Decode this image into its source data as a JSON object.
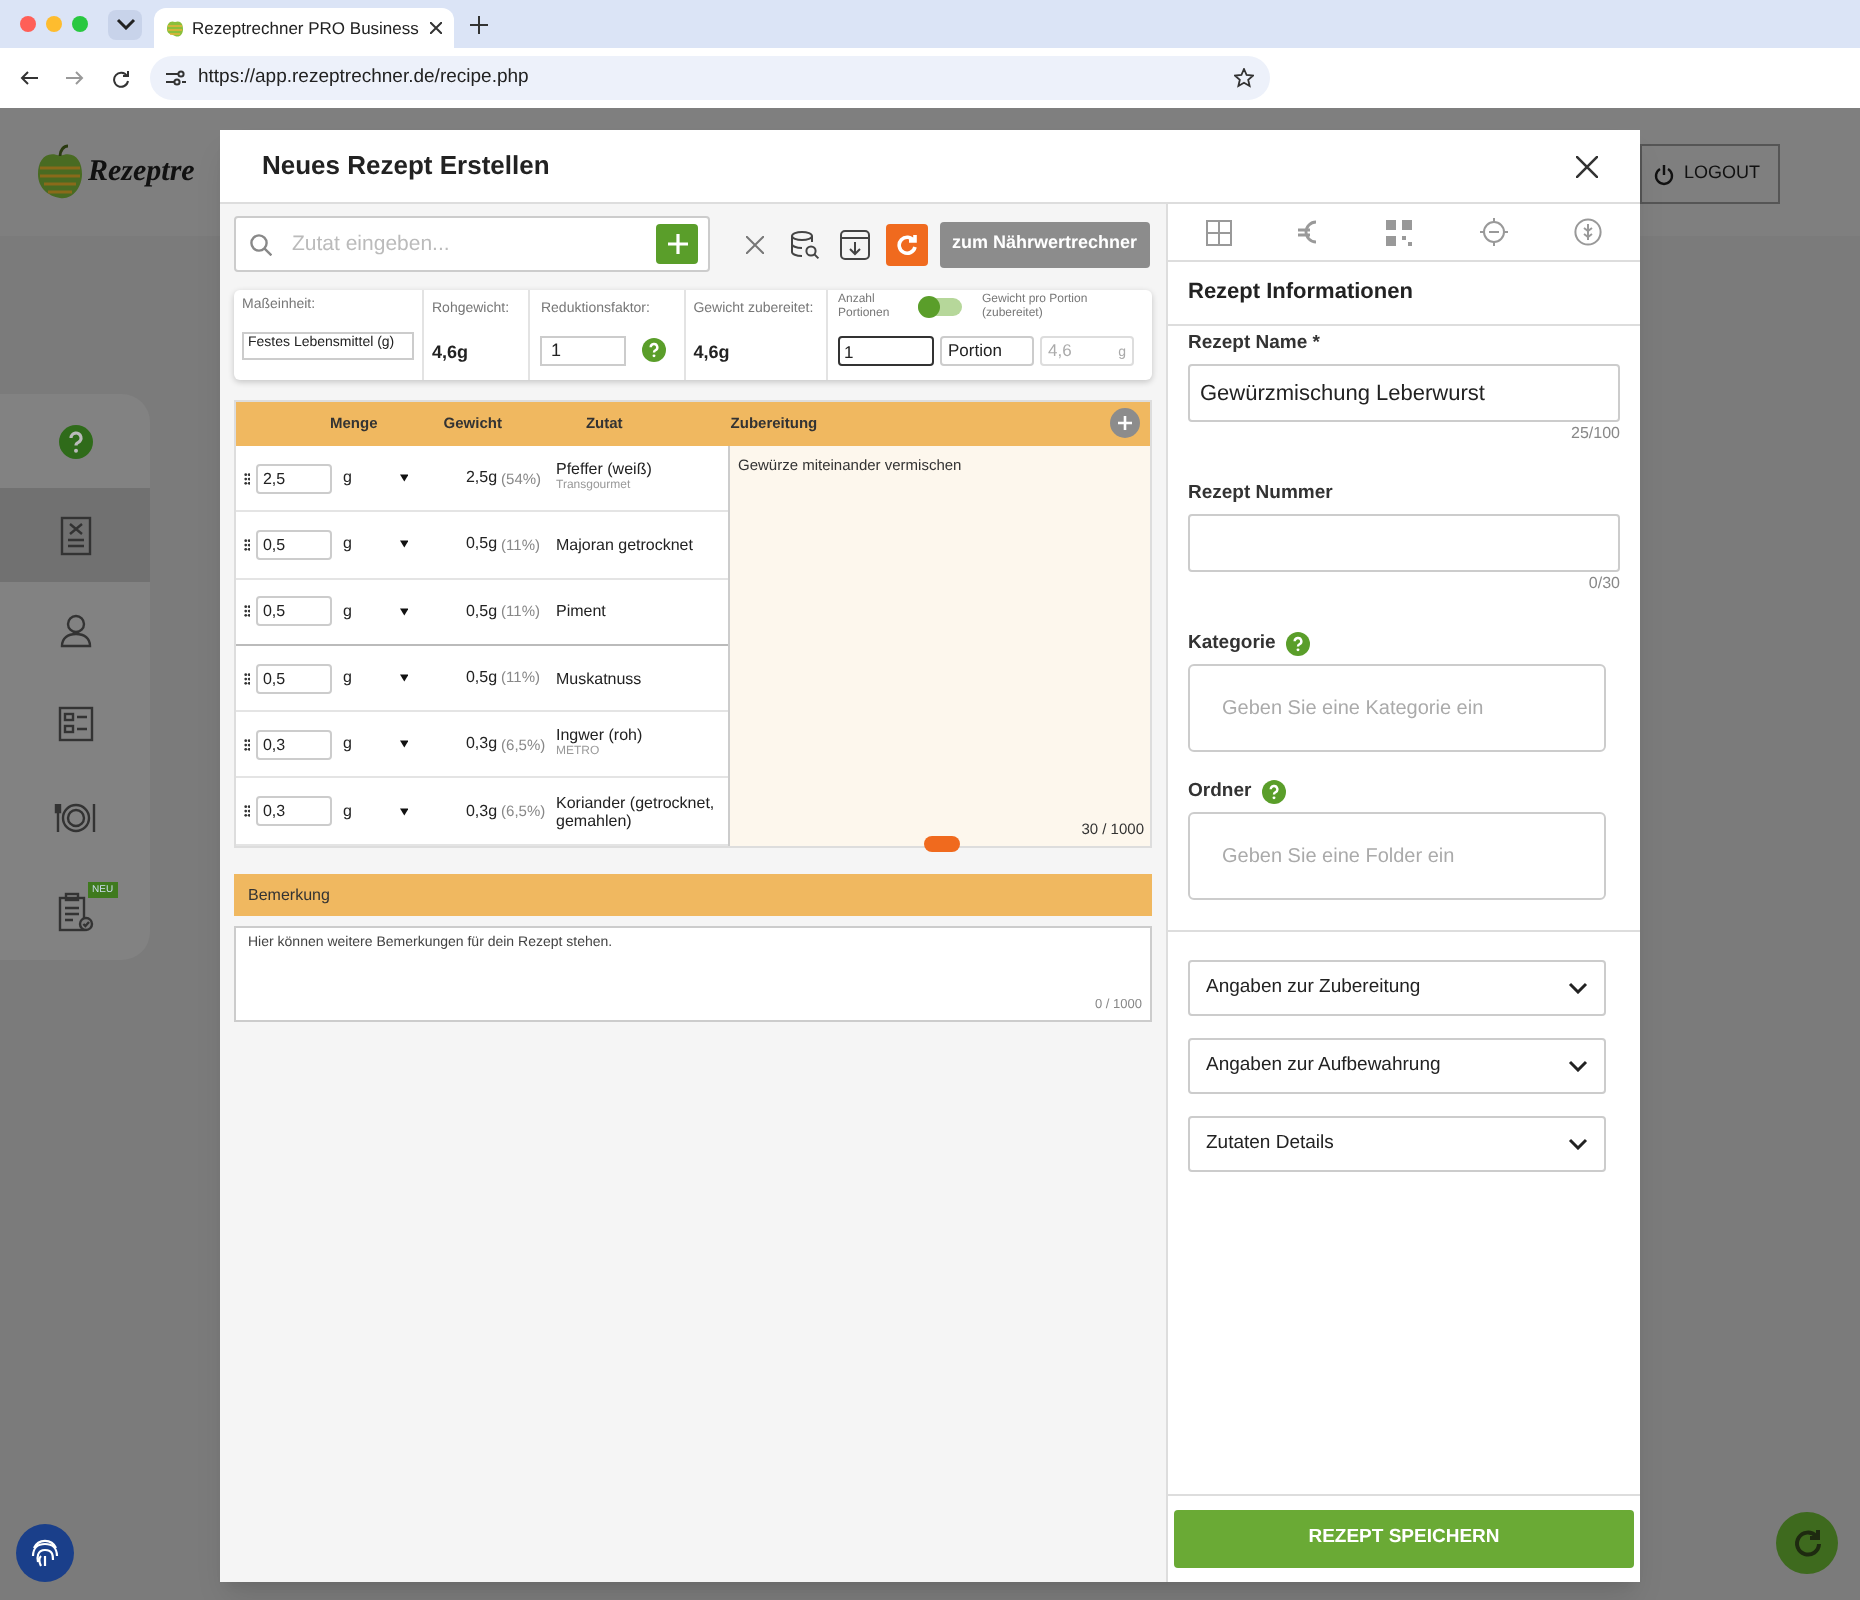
{
  "browser": {
    "tab_title": "Rezeptrechner PRO Business",
    "url": "https://app.rezeptrechner.de/recipe.php"
  },
  "app": {
    "logo_text": "Rezeptre",
    "logout": "LOGOUT",
    "sidebar": [
      {
        "kind": "help",
        "selected": false
      },
      {
        "kind": "recipe",
        "selected": true
      },
      {
        "kind": "person",
        "selected": false
      },
      {
        "kind": "checklist",
        "selected": false
      },
      {
        "kind": "plate",
        "selected": false
      },
      {
        "kind": "clipboard",
        "selected": false,
        "badge": "NEU"
      }
    ]
  },
  "modal": {
    "title": "Neues Rezept Erstellen",
    "search": {
      "placeholder": "Zutat eingeben..."
    },
    "nutrition_button": "zum Nährwertrechner",
    "summary": {
      "unit": {
        "label": "Maßeinheit:",
        "value": "Festes Lebensmittel (g)"
      },
      "raw_weight": {
        "label": "Rohgewicht:",
        "value": "4,6g"
      },
      "reduction": {
        "label": "Reduktionsfaktor:",
        "value": "1"
      },
      "cooked_weight": {
        "label": "Gewicht zubereitet:",
        "value": "4,6g"
      },
      "portions": {
        "label": "Anzahl Portionen",
        "on": false,
        "value": "1",
        "unit": "Portion"
      },
      "per_portion": {
        "label": "Gewicht pro Portion (zubereitet)",
        "value": "4,6",
        "unit": "g"
      }
    },
    "table": {
      "columns": [
        "Menge",
        "Gewicht",
        "Zutat"
      ],
      "prep_header": "Zubereitung",
      "rows": [
        {
          "amount": "2,5",
          "unit": "g",
          "weight": "2,5g",
          "share": "(54%)",
          "ingredient": "Pfeffer (weiß)",
          "supplier": "Transgourmet"
        },
        {
          "amount": "0,5",
          "unit": "g",
          "weight": "0,5g",
          "share": "(11%)",
          "ingredient": "Majoran getrocknet"
        },
        {
          "amount": "0,5",
          "unit": "g",
          "weight": "0,5g",
          "share": "(11%)",
          "ingredient": "Piment"
        },
        {
          "amount": "0,5",
          "unit": "g",
          "weight": "0,5g",
          "share": "(11%)",
          "ingredient": "Muskatnuss"
        },
        {
          "amount": "0,3",
          "unit": "g",
          "weight": "0,3g",
          "share": "(6,5%)",
          "ingredient": "Ingwer (roh)",
          "supplier": "METRO"
        },
        {
          "amount": "0,3",
          "unit": "g",
          "weight": "0,3g",
          "share": "(6,5%)",
          "ingredient": "Koriander (getrocknet, gemahlen)"
        }
      ],
      "preparation": "Gewürze miteinander vermischen",
      "prep_count": "30 / 1000"
    },
    "remark": {
      "header": "Bemerkung",
      "value": "Hier können weitere Bemerkungen für dein Rezept stehen.",
      "count": "0 / 1000"
    },
    "info": {
      "title": "Rezept Informationen",
      "fields": [
        {
          "label": "Rezept Name *",
          "value": "Gewürzmischung Leberwurst",
          "count": "25/100"
        },
        {
          "label": "Rezept Nummer",
          "count": "0/30"
        },
        {
          "label": "Kategorie",
          "help": true,
          "placeholder": "Geben Sie eine Kategorie ein"
        },
        {
          "label": "Ordner",
          "help": true,
          "placeholder": "Geben Sie eine Folder ein"
        }
      ],
      "sections": [
        {
          "label": "Angaben zur Zubereitung",
          "expanded": false
        },
        {
          "label": "Angaben zur Aufbewahrung",
          "expanded": false
        },
        {
          "label": "Zutaten Details",
          "expanded": false
        }
      ]
    },
    "save_button": "REZEPT SPEICHERN"
  }
}
